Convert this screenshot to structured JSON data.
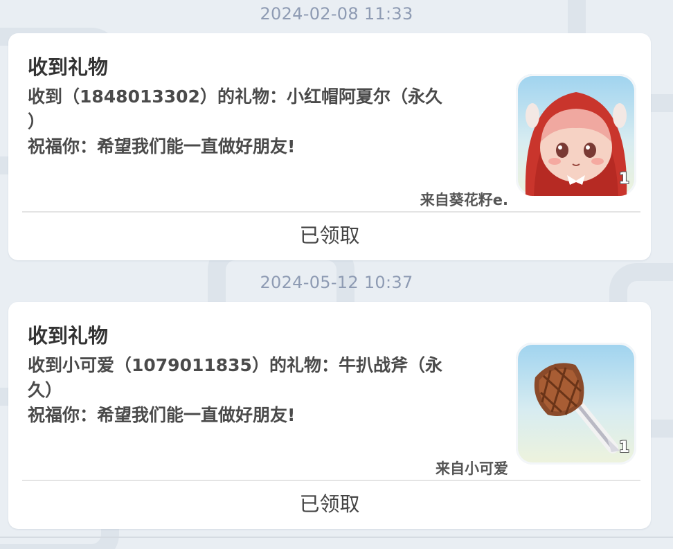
{
  "messages": [
    {
      "timestamp": "2024-02-08 11:33",
      "title": "收到礼物",
      "line1": "收到（1848013302）的礼物：小红帽阿夏尔（永久",
      "line2": "）",
      "blessing": "祝福你：希望我们能一直做好朋友!",
      "icon": "red-riding-hood-avatar-icon",
      "count": "1",
      "sender": "来自葵花籽e.",
      "claim_label": "已领取"
    },
    {
      "timestamp": "2024-05-12 10:37",
      "title": "收到礼物",
      "line1": "收到小可爱（1079011835）的礼物：牛扒战斧（永",
      "line2": "久）",
      "blessing": "祝福你：希望我们能一直做好朋友!",
      "icon": "steak-battle-axe-icon",
      "count": "1",
      "sender": "来自小可爱",
      "claim_label": "已领取"
    }
  ],
  "colors": {
    "background": "#e9eef3",
    "timestamp": "#8e9bb3",
    "card": "#ffffff",
    "text": "#4a4a4a"
  }
}
